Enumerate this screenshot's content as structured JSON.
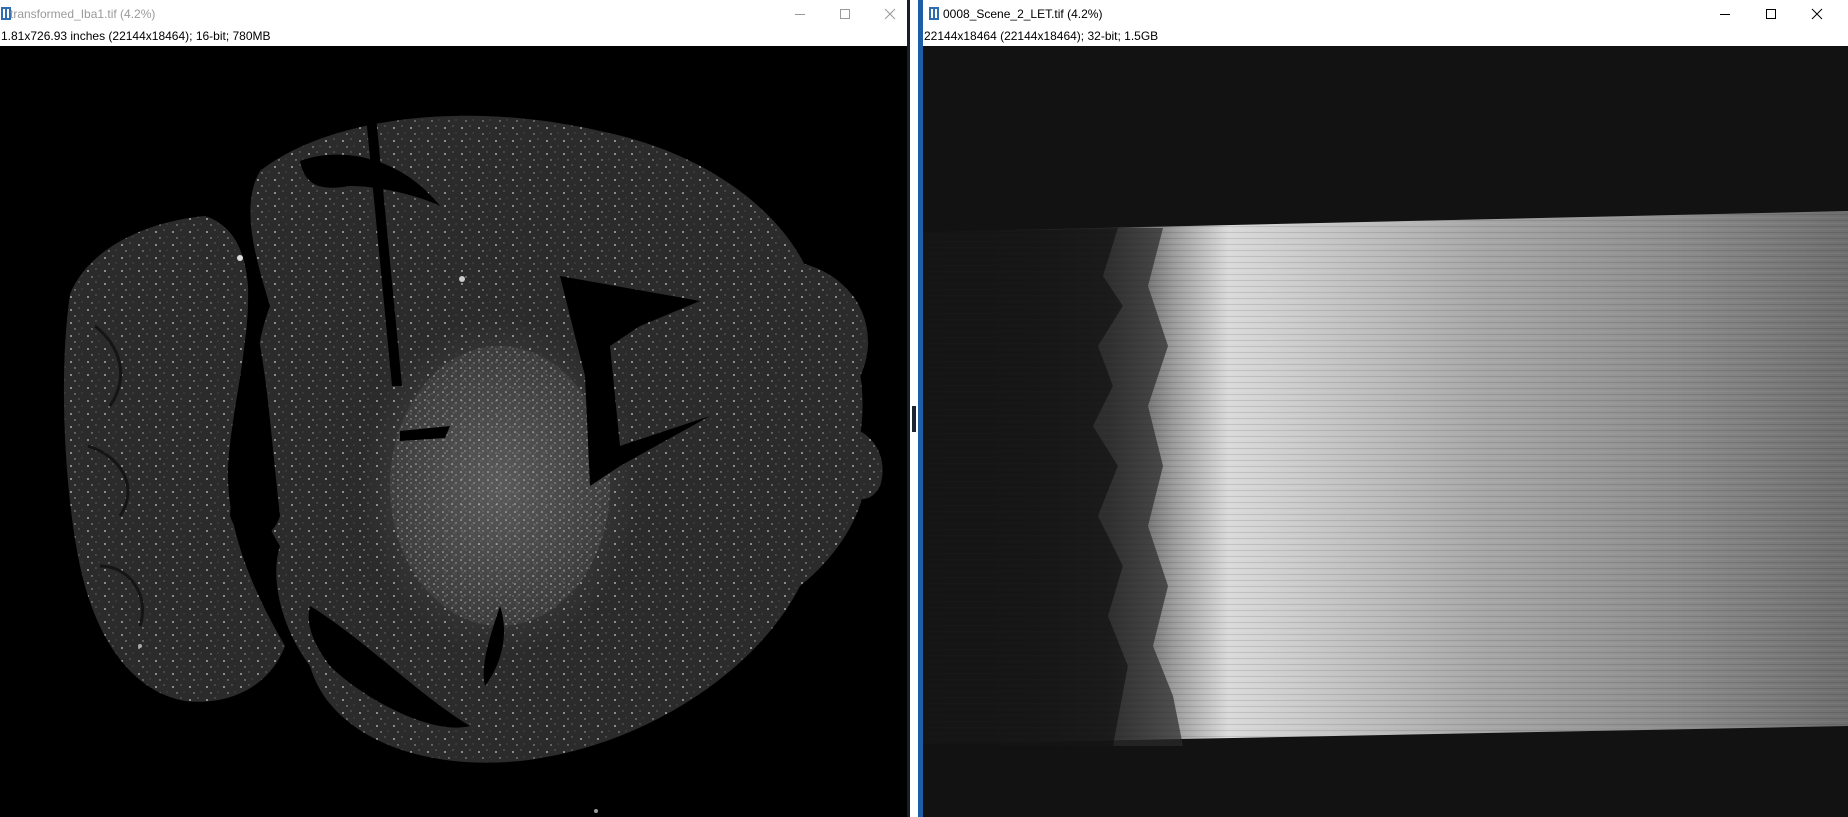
{
  "left_window": {
    "title": "transformed_Iba1.tif (4.2%)",
    "info": "1.81x726.93 inches (22144x18464); 16-bit; 780MB",
    "title_state": "inactive",
    "image": "brain-section-iba1-fluorescence"
  },
  "right_window": {
    "title": "0008_Scene_2_LET.tif (4.2%)",
    "info": "22144x18464   (22144x18464); 32-bit; 1.5GB",
    "title_state": "active",
    "image": "grayscale-intensity-gradient"
  },
  "controls": [
    "minimize-icon",
    "maximize-icon",
    "close-icon"
  ],
  "colors": {
    "title_inactive": "#9a9a9a",
    "title_active": "#000000",
    "active_border": "#1c5fa8",
    "image_background": "#000000",
    "right_image_background": "#121212"
  }
}
